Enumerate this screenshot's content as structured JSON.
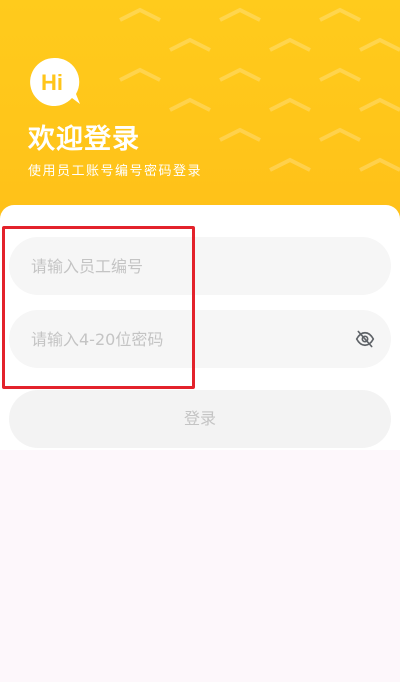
{
  "header": {
    "logo_text": "Hi",
    "title": "欢迎登录",
    "subtitle": "使用员工账号编号密码登录"
  },
  "form": {
    "employee_id": {
      "value": "",
      "placeholder": "请输入员工编号"
    },
    "password": {
      "value": "",
      "placeholder": "请输入4-20位密码",
      "toggle_icon": "eye-off-icon"
    },
    "login_label": "登录"
  },
  "colors": {
    "brand_yellow": "#ffc81b",
    "highlight_red": "#e3222b",
    "field_bg": "#f6f6f6",
    "placeholder_gray": "#c4c4c4"
  }
}
